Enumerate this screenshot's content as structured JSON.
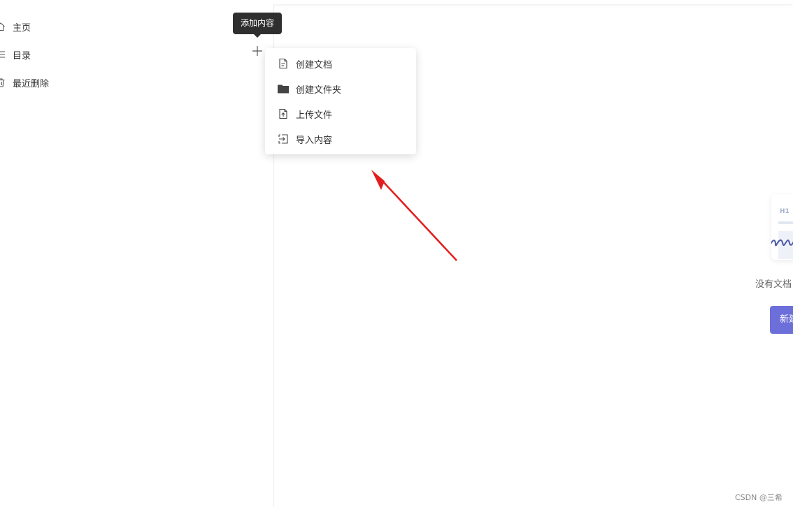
{
  "sidebar": {
    "items": [
      {
        "label": "主页",
        "icon": "home-icon"
      },
      {
        "label": "目录",
        "icon": "list-icon"
      },
      {
        "label": "最近删除",
        "icon": "trash-icon"
      }
    ],
    "add_button_icon": "plus-icon"
  },
  "tooltip": {
    "text": "添加内容"
  },
  "add_menu": {
    "items": [
      {
        "label": "创建文档",
        "icon": "document-icon"
      },
      {
        "label": "创建文件夹",
        "icon": "folder-icon"
      },
      {
        "label": "上传文件",
        "icon": "upload-file-icon"
      },
      {
        "label": "导入内容",
        "icon": "import-icon"
      }
    ]
  },
  "empty_state": {
    "card_heading": "H1",
    "message": "没有文档",
    "button_label": "新建"
  },
  "watermark": "CSDN @三希",
  "colors": {
    "accent": "#6c6fd9",
    "annotation_arrow": "#e31d1d",
    "tooltip_bg": "#2f2f2f"
  }
}
